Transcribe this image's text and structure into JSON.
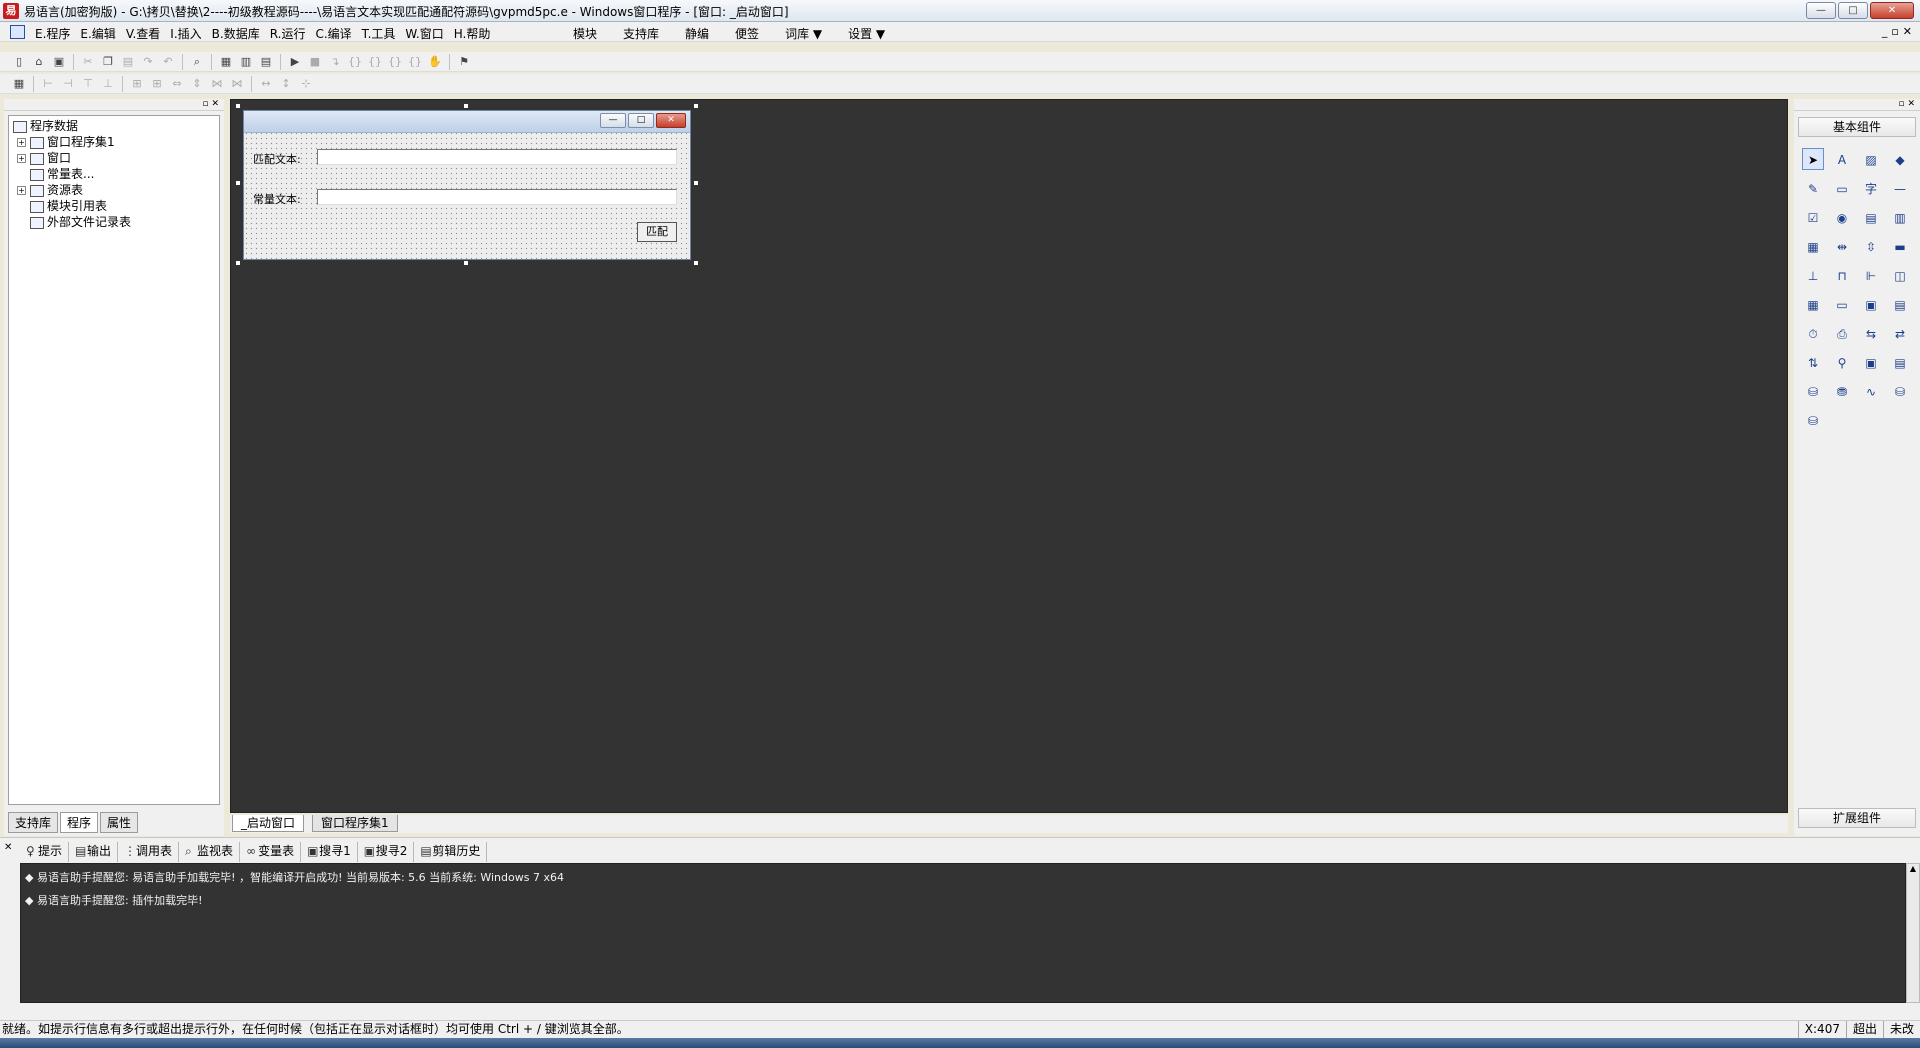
{
  "window": {
    "title": "易语言(加密狗版) - G:\\拷贝\\替换\\2----初级教程源码----\\易语言文本实现匹配通配符源码\\gvpmd5pc.e - Windows窗口程序 - [窗口: _启动窗口]",
    "app_icon": "易",
    "minimize_label": "—",
    "maximize_label": "□",
    "close_label": "✕"
  },
  "menu": {
    "items": [
      "E.程序",
      "E.编辑",
      "V.查看",
      "I.插入",
      "B.数据库",
      "R.运行",
      "C.编译",
      "T.工具",
      "W.窗口",
      "H.帮助"
    ],
    "right_items": [
      "模块",
      "支持库",
      "静编",
      "便签",
      "词库 ▼",
      "设置 ▼"
    ],
    "mdi_controls": [
      "_",
      "▫",
      "✕"
    ]
  },
  "left_panel": {
    "tree": [
      {
        "label": "程序数据",
        "level": 0,
        "expander": ""
      },
      {
        "label": "窗口程序集1",
        "level": 1,
        "expander": "+"
      },
      {
        "label": "窗口",
        "level": 1,
        "expander": "+"
      },
      {
        "label": "常量表...",
        "level": 1,
        "expander": ""
      },
      {
        "label": "资源表",
        "level": 1,
        "expander": "+"
      },
      {
        "label": "模块引用表",
        "level": 1,
        "expander": ""
      },
      {
        "label": "外部文件记录表",
        "level": 1,
        "expander": ""
      }
    ],
    "tabs": [
      "支持库",
      "程序",
      "属性"
    ]
  },
  "form": {
    "label1": "匹配文本:",
    "label2": "常量文本:",
    "input1_value": "",
    "input2_value": "",
    "button_label": "匹配"
  },
  "doc_tabs": [
    "_启动窗口",
    "窗口程序集1"
  ],
  "right_panel": {
    "title": "基本组件",
    "bottom": "扩展组件",
    "icons": [
      "pointer-icon",
      "label-icon",
      "picture-icon",
      "shape-icon",
      "edit-icon",
      "frame-icon",
      "font-icon",
      "line-icon",
      "checkbox-icon",
      "radio-icon",
      "listbox-icon",
      "combobox-icon",
      "grid-icon",
      "hscroll-icon",
      "vscroll-icon",
      "progress-icon",
      "slider-icon",
      "tab-icon",
      "tree-icon",
      "calendar-icon",
      "clock-icon",
      "printer-icon",
      "ddx-icon",
      "filebox-icon",
      "timer-icon",
      "socket-icon",
      "client-icon",
      "server-icon",
      "port-icon",
      "status-icon",
      "table-icon",
      "form-icon",
      "db-icon",
      "odbc-icon",
      "chart-icon",
      "odbc2-icon",
      "odbc3-icon"
    ]
  },
  "output": {
    "tabs": [
      "提示",
      "输出",
      "调用表",
      "监视表",
      "变量表",
      "搜寻1",
      "搜寻2",
      "剪辑历史"
    ],
    "lines": [
      "◆ 易语言助手提醒您: 易语言助手加载完毕! ，智能编译开启成功! 当前易版本: 5.6  当前系统: Windows 7 x64",
      "◆ 易语言助手提醒您: 插件加载完毕!"
    ]
  },
  "status": {
    "text": "就绪。如提示行信息有多行或超出提示行外，在任何时候（包括正在显示对话框时）均可使用 Ctrl + / 键浏览其全部。",
    "coord": "X:407",
    "mode": "超出",
    "state": "未改"
  }
}
